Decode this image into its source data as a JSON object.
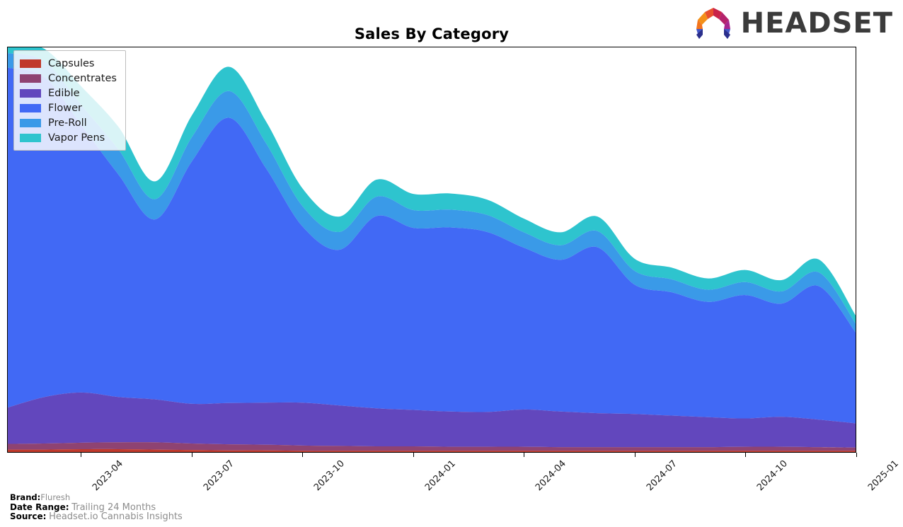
{
  "header": {
    "title": "Sales By Category",
    "logo_text": "HEADSET",
    "logo_icon": "headset-logo-icon"
  },
  "footer": {
    "brand_key": "Brand:",
    "brand_value": "Fluresh",
    "date_range_key": "Date Range:",
    "date_range_value": "Trailing 24 Months",
    "source_key": "Source:",
    "source_value": "Headset.io Cannabis Insights"
  },
  "legend": {
    "position": "top-left",
    "items": [
      {
        "label": "Capsules",
        "color": "#c0392b"
      },
      {
        "label": "Concentrates",
        "color": "#8e4372"
      },
      {
        "label": "Edible",
        "color": "#6247bd"
      },
      {
        "label": "Flower",
        "color": "#4169f5"
      },
      {
        "label": "Pre-Roll",
        "color": "#3a9ae8"
      },
      {
        "label": "Vapor Pens",
        "color": "#2ec4ce"
      }
    ]
  },
  "chart_data": {
    "type": "area",
    "stacked": true,
    "title": "Sales By Category",
    "xlabel": "",
    "ylabel": "",
    "grid": false,
    "legend_position": "top-left",
    "x": [
      "2023-02",
      "2023-03",
      "2023-04",
      "2023-05",
      "2023-06",
      "2023-07",
      "2023-08",
      "2023-09",
      "2023-10",
      "2023-11",
      "2023-12",
      "2024-01",
      "2024-02",
      "2024-03",
      "2024-04",
      "2024-05",
      "2024-06",
      "2024-07",
      "2024-08",
      "2024-09",
      "2024-10",
      "2024-11",
      "2024-12",
      "2025-01"
    ],
    "tick_labels": [
      "2023-04",
      "2023-07",
      "2023-10",
      "2024-01",
      "2024-04",
      "2024-07",
      "2024-10",
      "2025-01"
    ],
    "tick_x": [
      "2023-04",
      "2023-07",
      "2023-10",
      "2024-01",
      "2024-04",
      "2024-07",
      "2024-10",
      "2025-01"
    ],
    "ylim": [
      0,
      100
    ],
    "units": "relative sales (% of plot height)",
    "series": [
      {
        "name": "Capsules",
        "color": "#c0392b",
        "values": [
          0.6,
          0.6,
          0.7,
          0.7,
          0.6,
          0.5,
          0.4,
          0.4,
          0.3,
          0.3,
          0.3,
          0.3,
          0.3,
          0.3,
          0.3,
          0.3,
          0.3,
          0.3,
          0.3,
          0.3,
          0.3,
          0.3,
          0.3,
          0.3
        ]
      },
      {
        "name": "Concentrates",
        "color": "#8e4372",
        "values": [
          1.4,
          1.5,
          1.6,
          1.7,
          1.8,
          1.6,
          1.5,
          1.4,
          1.3,
          1.2,
          1.1,
          1.1,
          1.0,
          1.0,
          1.0,
          0.9,
          0.9,
          0.9,
          0.9,
          0.9,
          1.0,
          1.0,
          0.9,
          0.8
        ]
      },
      {
        "name": "Edible",
        "color": "#6247bd",
        "values": [
          9.0,
          11.5,
          12.4,
          11.2,
          10.6,
          9.8,
          10.2,
          10.4,
          10.6,
          10.0,
          9.4,
          9.0,
          8.7,
          8.6,
          9.2,
          8.8,
          8.4,
          8.2,
          7.8,
          7.4,
          7.0,
          7.4,
          6.8,
          6.0
        ]
      },
      {
        "name": "Flower",
        "color": "#4169f5",
        "values": [
          84.0,
          79.0,
          66.0,
          55.0,
          44.5,
          60.0,
          70.5,
          58.0,
          43.5,
          38.5,
          47.5,
          45.0,
          45.5,
          44.5,
          40.0,
          37.5,
          41.0,
          32.0,
          30.5,
          28.5,
          30.5,
          28.0,
          33.0,
          22.5
        ]
      },
      {
        "name": "Pre-Roll",
        "color": "#3a9ae8",
        "values": [
          3.6,
          4.0,
          5.0,
          6.2,
          5.0,
          6.0,
          6.6,
          6.2,
          5.0,
          4.4,
          4.8,
          4.4,
          4.4,
          4.2,
          3.8,
          3.6,
          4.0,
          3.4,
          3.2,
          3.0,
          3.2,
          3.0,
          3.4,
          2.2
        ]
      },
      {
        "name": "Vapor Pens",
        "color": "#2ec4ce",
        "values": [
          2.6,
          3.0,
          4.6,
          5.6,
          4.4,
          5.4,
          6.0,
          5.4,
          4.4,
          3.8,
          4.2,
          4.0,
          4.0,
          3.8,
          3.4,
          3.2,
          3.6,
          3.0,
          2.9,
          2.8,
          3.0,
          2.8,
          3.2,
          2.0
        ]
      }
    ]
  }
}
